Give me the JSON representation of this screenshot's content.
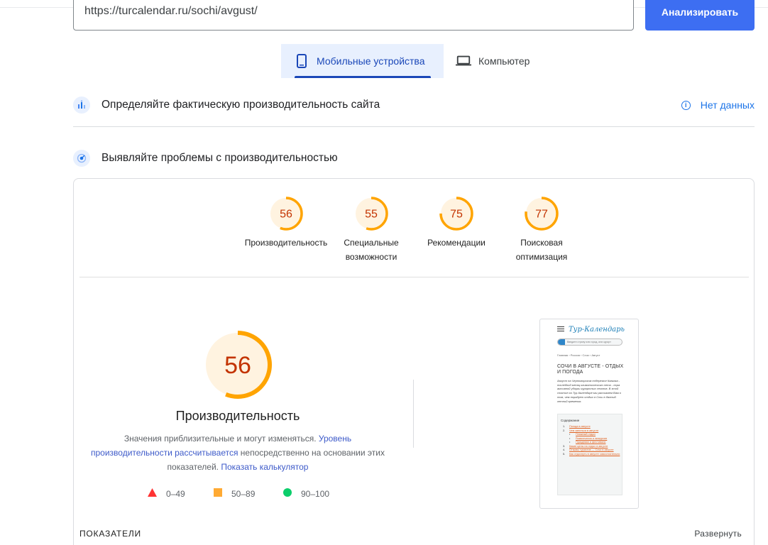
{
  "url_bar": {
    "value": "https://turcalendar.ru/sochi/avgust/",
    "button_label": "Анализировать"
  },
  "device_tabs": [
    {
      "label": "Мобильные устройства",
      "icon": "smartphone-icon",
      "selected": true
    },
    {
      "label": "Компьютер",
      "icon": "laptop-icon",
      "selected": false
    }
  ],
  "field_data": {
    "title": "Определяйте фактическую производительность сайта",
    "status": "Нет данных",
    "icon": "field-data-icon"
  },
  "lab_data": {
    "title": "Выявляйте проблемы с производительностью",
    "icon": "lab-data-icon"
  },
  "scores": [
    {
      "value": 56,
      "label": "Производительность"
    },
    {
      "value": 55,
      "label": "Специальные возможности"
    },
    {
      "value": 75,
      "label": "Рекомендации"
    },
    {
      "value": 77,
      "label": "Поисковая оптимизация"
    }
  ],
  "performance": {
    "score": 56,
    "title": "Производительность",
    "desc_part1": "Значения приблизительные и могут изменяться. ",
    "desc_link1": "Уровень производительности рассчитывается",
    "desc_part2": " непосредственно на основании этих показателей. ",
    "desc_link2": "Показать калькулятор"
  },
  "legend": [
    {
      "range": "0–49",
      "shape": "triangle",
      "color": "#ff3333"
    },
    {
      "range": "50–89",
      "shape": "square",
      "color": "#ffaa33"
    },
    {
      "range": "90–100",
      "shape": "circle",
      "color": "#0cce6b"
    }
  ],
  "colors": {
    "average": "#ffa400",
    "average_text": "#c33300",
    "average_bg": "#fff3e0",
    "accent": "#3d6ef2"
  },
  "thumbnail": {
    "logo": "Тур-Календарь",
    "search_placeholder": "Введите страну или город, или курорт",
    "breadcrumb": "Главная › Россия › Сочи › Август",
    "heading": "СОЧИ В АВГУСТЕ - ОТДЫХ И ПОГОДА",
    "text": "Август на Черноморском побережье Кавказа - последний месяц климатического лета - пора активной уборки курортных сезонов. В этой статье на Тур-Календаре мы расскажем Вам о том, чем порадует отдых в Сочи в данный летний временах.",
    "toc_title": "Содержание",
    "toc_items": [
      {
        "n": "1.",
        "text": "Погода в августе"
      },
      {
        "n": "2.",
        "text": "Чем заняться в августе"
      },
      {
        "n": "•",
        "text": "Пляжный отдых",
        "sub": true
      },
      {
        "n": "•",
        "text": "Развлечения и экскурсии",
        "sub": true
      },
      {
        "n": "•",
        "text": "Праздники и фестивали",
        "sub": true
      },
      {
        "n": "3.",
        "text": "Какие цены на отдых в августе"
      },
      {
        "n": "4.",
        "text": "Отзывы туристов — Сочи в августе"
      },
      {
        "n": "5.",
        "text": "Как отдохнуть в августе самостоятельно"
      }
    ]
  },
  "footer": {
    "indicators_label": "ПОКАЗАТЕЛИ",
    "expand_label": "Развернуть"
  }
}
